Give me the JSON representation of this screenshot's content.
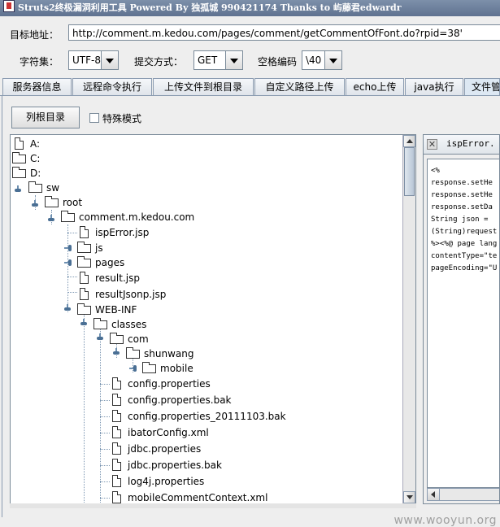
{
  "window": {
    "title": "Struts2终极漏洞利用工具   Powered By 独孤城 990421174 Thanks to 屿藤君edwardr"
  },
  "form": {
    "url_label": "目标地址：",
    "url_value": "http://comment.m.kedou.com/pages/comment/getCommentOfFont.do?rpid=38'",
    "charset_label": "字符集：",
    "charset_value": "UTF-8",
    "method_label": "提交方式：",
    "method_value": "GET",
    "space_label": "空格编码",
    "space_value": "\\40"
  },
  "tabs": [
    {
      "label": "服务器信息",
      "active": false
    },
    {
      "label": "远程命令执行",
      "active": false
    },
    {
      "label": "上传文件到根目录",
      "active": false
    },
    {
      "label": "自定义路径上传",
      "active": false
    },
    {
      "label": "echo上传",
      "active": false
    },
    {
      "label": "java执行",
      "active": false
    },
    {
      "label": "文件管理",
      "active": true
    }
  ],
  "toolbar": {
    "list_root_label": "列根目录",
    "special_mode_label": "特殊模式",
    "special_mode_checked": false
  },
  "tree": [
    {
      "name": "A:",
      "type": "file"
    },
    {
      "name": "C:",
      "type": "folder"
    },
    {
      "name": "D:",
      "type": "folder"
    },
    {
      "name": "sw",
      "type": "folder"
    },
    {
      "name": "root",
      "type": "folder"
    },
    {
      "name": "comment.m.kedou.com",
      "type": "folder"
    },
    {
      "name": "ispError.jsp",
      "type": "file"
    },
    {
      "name": "js",
      "type": "folder"
    },
    {
      "name": "pages",
      "type": "folder"
    },
    {
      "name": "result.jsp",
      "type": "file"
    },
    {
      "name": "resultJsonp.jsp",
      "type": "file"
    },
    {
      "name": "WEB-INF",
      "type": "folder"
    },
    {
      "name": "classes",
      "type": "folder"
    },
    {
      "name": "com",
      "type": "folder"
    },
    {
      "name": "shunwang",
      "type": "folder"
    },
    {
      "name": "mobile",
      "type": "folder"
    },
    {
      "name": "config.properties",
      "type": "file"
    },
    {
      "name": "config.properties.bak",
      "type": "file"
    },
    {
      "name": "config.properties_20111103.bak",
      "type": "file"
    },
    {
      "name": "ibatorConfig.xml",
      "type": "file"
    },
    {
      "name": "jdbc.properties",
      "type": "file"
    },
    {
      "name": "jdbc.properties.bak",
      "type": "file"
    },
    {
      "name": "log4j.properties",
      "type": "file"
    },
    {
      "name": "mobileCommentContext.xml",
      "type": "file"
    }
  ],
  "editor": {
    "tab_label": "ispError.",
    "lines": [
      "<%",
      "response.setHe",
      "response.setHe",
      "response.setDa",
      "String json =",
      "(String)request",
      "%><%@ page lang",
      "contentType=\"te",
      "pageEncoding=\"U"
    ]
  },
  "watermark": "www.wooyun.org"
}
